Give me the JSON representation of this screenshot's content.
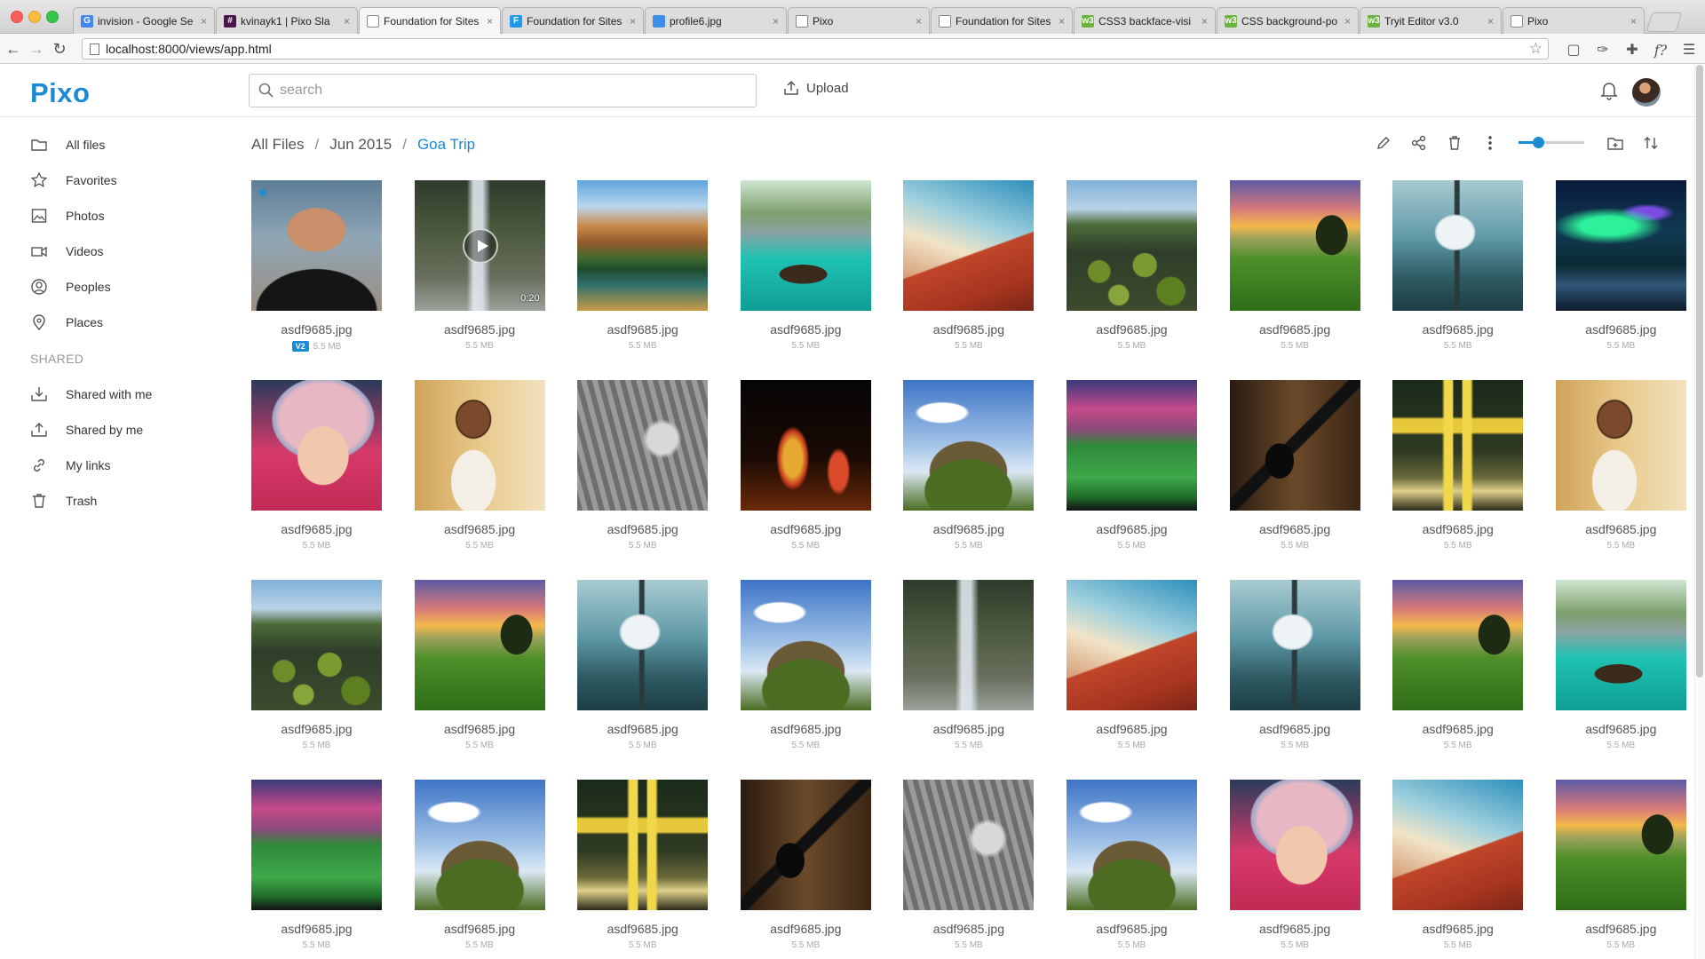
{
  "browser": {
    "tabs": [
      {
        "label": "invision - Google Se",
        "fav": "G",
        "color": "#4285f4",
        "active": false
      },
      {
        "label": "kvinayk1 | Pixo Sla",
        "fav": "#",
        "color": "#4a154b",
        "active": false
      },
      {
        "label": "Foundation for Sites",
        "fav": "",
        "color": "#ffffff",
        "active": true
      },
      {
        "label": "Foundation for Sites",
        "fav": "F",
        "color": "#2199e8",
        "active": false
      },
      {
        "label": "profile6.jpg",
        "fav": "",
        "color": "#3d8ee8",
        "active": false
      },
      {
        "label": "Pixo",
        "fav": "",
        "color": "#ffffff",
        "active": false
      },
      {
        "label": "Foundation for Sites",
        "fav": "",
        "color": "#ffffff",
        "active": false
      },
      {
        "label": "CSS3 backface-visi",
        "fav": "w3",
        "color": "#6cb33f",
        "active": false
      },
      {
        "label": "CSS background-po",
        "fav": "w3",
        "color": "#6cb33f",
        "active": false
      },
      {
        "label": "Tryit Editor v3.0",
        "fav": "w3",
        "color": "#6cb33f",
        "active": false
      },
      {
        "label": "Pixo",
        "fav": "",
        "color": "#ffffff",
        "active": false
      }
    ],
    "url": "localhost:8000/views/app.html"
  },
  "header": {
    "logo": "Pixo",
    "search_placeholder": "search",
    "upload_label": "Upload"
  },
  "sidebar": {
    "items": [
      {
        "label": "All files",
        "icon": "folder-icon"
      },
      {
        "label": "Favorites",
        "icon": "star-icon"
      },
      {
        "label": "Photos",
        "icon": "photo-icon"
      },
      {
        "label": "Videos",
        "icon": "video-icon"
      },
      {
        "label": "Peoples",
        "icon": "person-icon"
      },
      {
        "label": "Places",
        "icon": "map-pin-icon"
      }
    ],
    "shared_title": "SHARED",
    "shared_items": [
      {
        "label": "Shared with me",
        "icon": "download-tray-icon"
      },
      {
        "label": "Shared by me",
        "icon": "upload-tray-icon"
      },
      {
        "label": "My links",
        "icon": "link-icon"
      },
      {
        "label": "Trash",
        "icon": "trash-icon"
      }
    ]
  },
  "breadcrumb": {
    "root": "All Files",
    "middle": "Jun 2015",
    "current": "Goa Trip",
    "separator": "/"
  },
  "toolbar": {
    "zoom_level": 0.3
  },
  "colors": {
    "accent": "#1b8bd6"
  },
  "files": {
    "rows": [
      [
        {
          "name": "asdf9685.jpg",
          "size": "5.5 MB",
          "scene": "portrait",
          "badge": "V2",
          "starred": true
        },
        {
          "name": "asdf9685.jpg",
          "size": "5.5 MB",
          "scene": "waterfall",
          "video": true,
          "duration": "0:20"
        },
        {
          "name": "asdf9685.jpg",
          "size": "5.5 MB",
          "scene": "mountainlake"
        },
        {
          "name": "asdf9685.jpg",
          "size": "5.5 MB",
          "scene": "lagoon"
        },
        {
          "name": "asdf9685.jpg",
          "size": "5.5 MB",
          "scene": "redrock"
        },
        {
          "name": "asdf9685.jpg",
          "size": "5.5 MB",
          "scene": "lilypads"
        },
        {
          "name": "asdf9685.jpg",
          "size": "5.5 MB",
          "scene": "sunsetfield"
        },
        {
          "name": "asdf9685.jpg",
          "size": "5.5 MB",
          "scene": "whitetree"
        },
        {
          "name": "asdf9685.jpg",
          "size": "5.5 MB",
          "scene": "aurora"
        }
      ],
      [
        {
          "name": "asdf9685.jpg",
          "size": "5.5 MB",
          "scene": "childhat"
        },
        {
          "name": "asdf9685.jpg",
          "size": "5.5 MB",
          "scene": "girlcurly"
        },
        {
          "name": "asdf9685.jpg",
          "size": "5.5 MB",
          "scene": "bwflute"
        },
        {
          "name": "asdf9685.jpg",
          "size": "5.5 MB",
          "scene": "dancer"
        },
        {
          "name": "asdf9685.jpg",
          "size": "5.5 MB",
          "scene": "hill"
        },
        {
          "name": "asdf9685.jpg",
          "size": "5.5 MB",
          "scene": "stadium"
        },
        {
          "name": "asdf9685.jpg",
          "size": "5.5 MB",
          "scene": "guitar"
        },
        {
          "name": "asdf9685.jpg",
          "size": "5.5 MB",
          "scene": "indiagate"
        },
        {
          "name": "asdf9685.jpg",
          "size": "5.5 MB",
          "scene": "girlcurly"
        }
      ],
      [
        {
          "name": "asdf9685.jpg",
          "size": "5.5 MB",
          "scene": "lilypads"
        },
        {
          "name": "asdf9685.jpg",
          "size": "5.5 MB",
          "scene": "sunsetfield"
        },
        {
          "name": "asdf9685.jpg",
          "size": "5.5 MB",
          "scene": "whitetree"
        },
        {
          "name": "asdf9685.jpg",
          "size": "5.5 MB",
          "scene": "hill"
        },
        {
          "name": "asdf9685.jpg",
          "size": "5.5 MB",
          "scene": "waterfall"
        },
        {
          "name": "asdf9685.jpg",
          "size": "5.5 MB",
          "scene": "redrock"
        },
        {
          "name": "asdf9685.jpg",
          "size": "5.5 MB",
          "scene": "whitetree"
        },
        {
          "name": "asdf9685.jpg",
          "size": "5.5 MB",
          "scene": "sunsetfield"
        },
        {
          "name": "asdf9685.jpg",
          "size": "5.5 MB",
          "scene": "lagoon"
        }
      ],
      [
        {
          "name": "asdf9685.jpg",
          "size": "5.5 MB",
          "scene": "stadium"
        },
        {
          "name": "asdf9685.jpg",
          "size": "5.5 MB",
          "scene": "hill"
        },
        {
          "name": "asdf9685.jpg",
          "size": "5.5 MB",
          "scene": "indiagate"
        },
        {
          "name": "asdf9685.jpg",
          "size": "5.5 MB",
          "scene": "guitar"
        },
        {
          "name": "asdf9685.jpg",
          "size": "5.5 MB",
          "scene": "bwflute"
        },
        {
          "name": "asdf9685.jpg",
          "size": "5.5 MB",
          "scene": "hill"
        },
        {
          "name": "asdf9685.jpg",
          "size": "5.5 MB",
          "scene": "childhat"
        },
        {
          "name": "asdf9685.jpg",
          "size": "5.5 MB",
          "scene": "redrock"
        },
        {
          "name": "asdf9685.jpg",
          "size": "5.5 MB",
          "scene": "sunsetfield"
        }
      ]
    ]
  }
}
